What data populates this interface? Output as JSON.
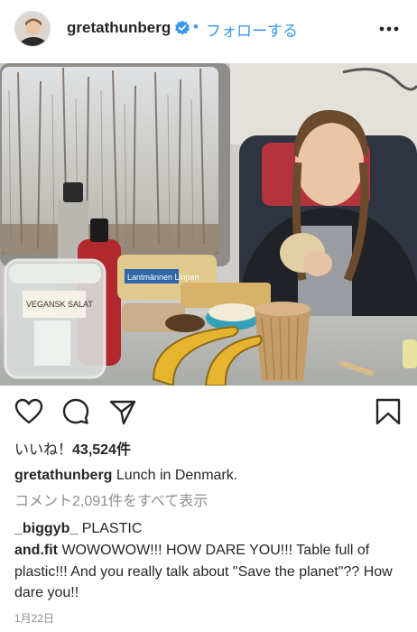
{
  "post": {
    "username": "gretathunberg",
    "follow_label": "フォローする",
    "separator": "•",
    "likes_prefix": "いいね！",
    "likes_count": "43,524件",
    "caption_text": "Lunch in Denmark.",
    "view_all_comments": "コメント2,091件をすべて表示",
    "comments": [
      {
        "username": "_biggyb_",
        "text": "PLASTIC"
      },
      {
        "username": "and.fit",
        "text": "WOWOWOW!!! HOW DARE YOU!!! Table full of plastic!!! And you really talk about \"Save the planet\"?? How dare you!!"
      }
    ],
    "date": "1月22日"
  },
  "photo_labels": {
    "jar_label": "VEGANSK SALAT",
    "bread_brand": "Lantmännen Linpan"
  },
  "colors": {
    "link": "#3897f0",
    "text": "#262626",
    "muted": "#8e8e8e"
  },
  "icons": [
    "verified-badge-icon",
    "more-options-icon",
    "heart-icon",
    "comment-icon",
    "share-icon",
    "bookmark-icon"
  ]
}
